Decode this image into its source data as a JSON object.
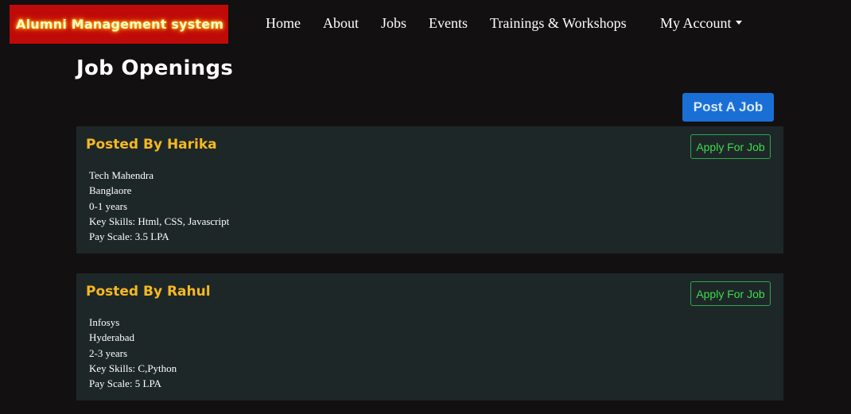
{
  "brand": {
    "title": "Alumni Management system"
  },
  "nav": {
    "items": [
      {
        "label": "Home"
      },
      {
        "label": "About"
      },
      {
        "label": "Jobs"
      },
      {
        "label": "Events"
      },
      {
        "label": "Trainings & Workshops"
      }
    ],
    "account_label": "My Account",
    "account_icon": "caret-down-icon"
  },
  "page": {
    "title": "Job Openings",
    "post_button": "Post A Job"
  },
  "jobs": [
    {
      "posted_by": "Posted By Harika",
      "apply_label": "Apply For Job",
      "company": "Tech Mahendra",
      "location": "Banglaore",
      "experience": "0-1 years",
      "skills": "Key Skills: Html, CSS, Javascript",
      "pay": "Pay Scale: 3.5 LPA"
    },
    {
      "posted_by": "Posted By Rahul",
      "apply_label": "Apply For Job",
      "company": "Infosys",
      "location": "Hyderabad",
      "experience": "2-3 years",
      "skills": "Key Skills: C,Python",
      "pay": "Pay Scale: 5 LPA"
    }
  ],
  "colors": {
    "background": "#121011",
    "brand_bg": "#bf0a0a",
    "card_bg": "#1e2728",
    "header_accent": "#f5b921",
    "primary_button": "#1a6fd6",
    "apply_outline": "#2ea44f"
  }
}
